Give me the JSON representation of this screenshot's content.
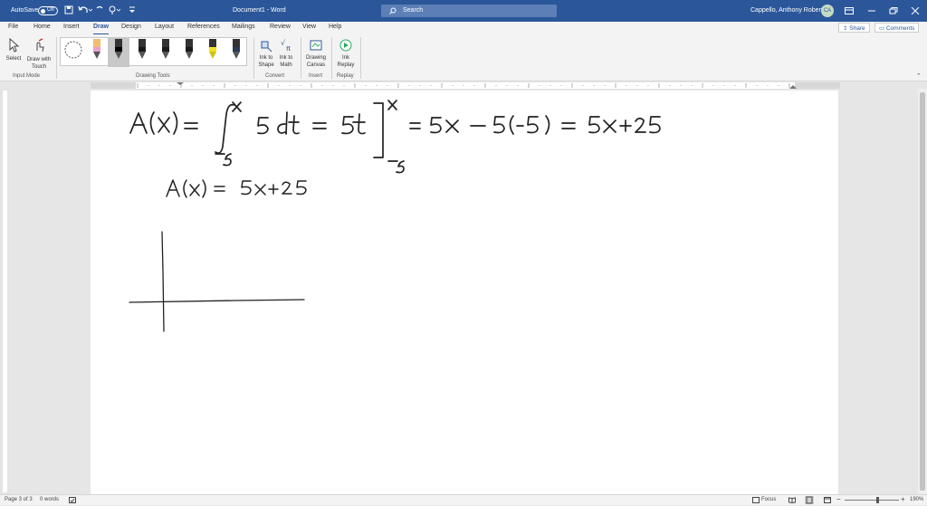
{
  "titlebar": {
    "autosave_label": "AutoSave",
    "autosave_state": "Off",
    "doc_title": "Document1 - Word",
    "search_placeholder": "Search",
    "user_name": "Cappello, Anthony Robert",
    "user_initials": "CA",
    "bg_color": "#2b579a"
  },
  "tabs": [
    {
      "label": "File"
    },
    {
      "label": "Home"
    },
    {
      "label": "Insert"
    },
    {
      "label": "Draw",
      "active": true
    },
    {
      "label": "Design"
    },
    {
      "label": "Layout"
    },
    {
      "label": "References"
    },
    {
      "label": "Mailings"
    },
    {
      "label": "Review"
    },
    {
      "label": "View"
    },
    {
      "label": "Help"
    }
  ],
  "header_buttons": {
    "share": "Share",
    "comments": "Comments"
  },
  "ribbon": {
    "select": "Select",
    "draw_touch_1": "Draw with",
    "draw_touch_2": "Touch",
    "input_mode": "Input Mode",
    "drawing_tools": "Drawing Tools",
    "ink_shape_1": "Ink to",
    "ink_shape_2": "Shape",
    "ink_math_1": "Ink to",
    "ink_math_2": "Math",
    "convert": "Convert",
    "canvas_1": "Drawing",
    "canvas_2": "Canvas",
    "insert": "Insert",
    "replay_1": "Ink",
    "replay_2": "Replay",
    "replay": "Replay"
  },
  "pens": [
    {
      "name": "lasso-select",
      "color": "#ffffff"
    },
    {
      "name": "pen-pink",
      "color": "#e8a0d0"
    },
    {
      "name": "pen-black-selected",
      "color": "#000000"
    },
    {
      "name": "pen-dark-1",
      "color": "#1a1a1a"
    },
    {
      "name": "pen-dark-2",
      "color": "#1a1a1a"
    },
    {
      "name": "pen-dark-3",
      "color": "#1a1a1a"
    },
    {
      "name": "highlighter-yellow",
      "color": "#f5e11d"
    },
    {
      "name": "pen-galaxy",
      "color": "#2b3a55"
    }
  ],
  "document": {
    "ink_line1": "A(x) = ∫ 5 dt = 5t ] = 5x − 5(−5) = 5x + 25",
    "ink_line2": "A(x) = 5x + 25",
    "ink_color": "#222222"
  },
  "status": {
    "page": "Page 3 of 3",
    "words": "0 words",
    "focus": "Focus",
    "zoom": "190%"
  }
}
